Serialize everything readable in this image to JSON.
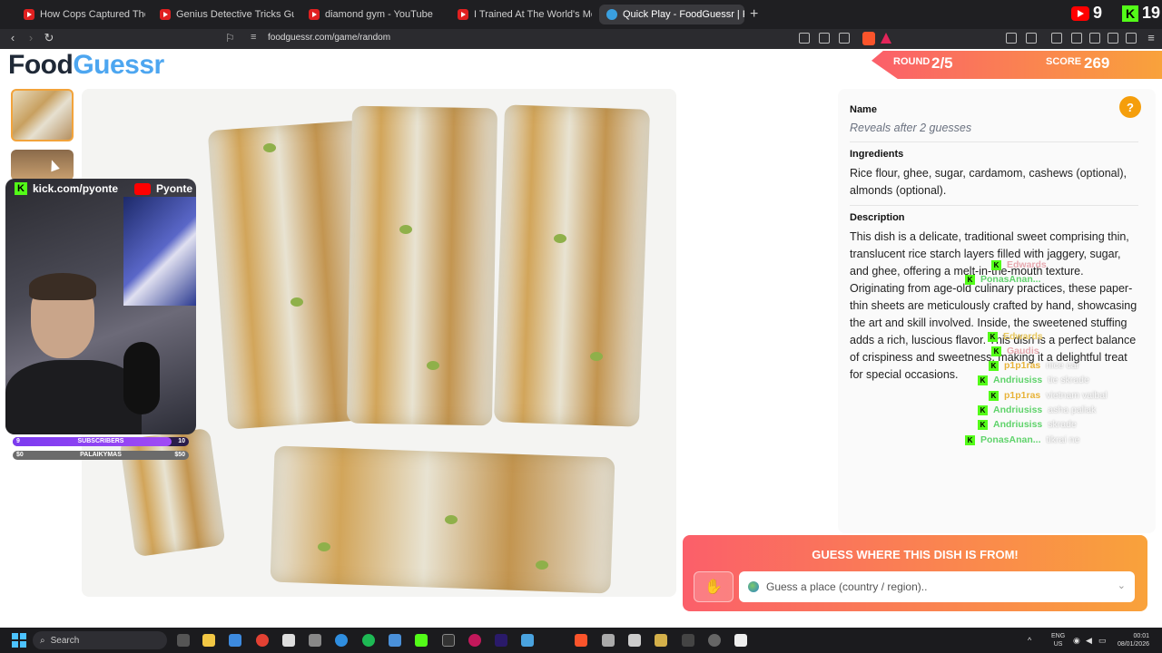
{
  "browser": {
    "tabs": [
      {
        "title": "How Cops Captured The Minnesota I",
        "active": false
      },
      {
        "title": "Genius Detective Tricks Guilty Suspe",
        "active": false
      },
      {
        "title": "diamond gym - YouTube",
        "active": false
      },
      {
        "title": "I Trained At The World's Most Dange",
        "active": false
      },
      {
        "title": "Quick Play - FoodGuessr | FoodG",
        "active": true
      }
    ],
    "new_tab": "+",
    "close": "✕",
    "youtube_count": "9",
    "kick_count": "19",
    "url": "foodguessr.com/game/random"
  },
  "site": {
    "logo_food": "Food",
    "logo_guessr": "Guessr",
    "round_label": "ROUND",
    "round_value": "2/5",
    "score_label": "SCORE",
    "score_value": "269"
  },
  "stream": {
    "kick_handle": "kick.com/pyonte",
    "youtube_name": "Pyonte",
    "subscribers": {
      "label": "SUBSCRIBERS",
      "current": "9",
      "goal": "10",
      "progress": 0.9
    },
    "donations": {
      "label": "PALAIKYMAS",
      "current": "$0",
      "goal": "$50",
      "progress": 0.0
    }
  },
  "info_panel": {
    "name_heading": "Name",
    "name_value": "Reveals after 2 guesses",
    "ingredients_heading": "Ingredients",
    "ingredients_text": "Rice flour, ghee, sugar, cardamom, cashews (optional), almonds (optional).",
    "description_heading": "Description",
    "description_text": "This dish is a delicate, traditional sweet comprising thin, translucent rice starch layers filled with jaggery, sugar, and ghee, offering a melt-in-the-mouth texture. Originating from age-old culinary practices, these paper-thin sheets are meticulously crafted by hand, showcasing the art and skill involved. Inside, the sweetened stuffing adds a rich, luscious flavor. This dish is a perfect balance of crispiness and sweetness, making it a delightful treat for special occasions.",
    "help": "?"
  },
  "chat": [
    {
      "user": "Edwards",
      "color": "#e7a9b0",
      "msg": ""
    },
    {
      "user": "PonasAnan...",
      "color": "#5fd36b",
      "msg": ""
    },
    {
      "user": "Edwards",
      "color": "#e7c75f",
      "msg": ""
    },
    {
      "user": "Gaudis",
      "color": "#e7a9b0",
      "msg": ""
    },
    {
      "user": "p1p1ras",
      "color": "#e8b339",
      "msg": "nice car"
    },
    {
      "user": "Andriusiss",
      "color": "#5fd36b",
      "msg": "tie skrade"
    },
    {
      "user": "p1p1ras",
      "color": "#e8b339",
      "msg": "vietnam vaibal"
    },
    {
      "user": "Andriusiss",
      "color": "#5fd36b",
      "msg": "asha paliak"
    },
    {
      "user": "Andriusiss",
      "color": "#5fd36b",
      "msg": "skrade"
    },
    {
      "user": "PonasAnan...",
      "color": "#5fd36b",
      "msg": "tikrai ne"
    }
  ],
  "guess": {
    "title": "GUESS WHERE THIS DISH IS FROM!",
    "placeholder": "Guess a place (country / region)..",
    "button_icon": "hand-icon"
  },
  "taskbar": {
    "search": "Search",
    "lang_top": "ENG",
    "lang_bottom": "US",
    "time": "00:01",
    "date": "08/01/2026"
  },
  "colors": {
    "accent_gradient_start": "#fb5f6a",
    "accent_gradient_end": "#f9a23b",
    "logo_blue": "#4da6f0",
    "kick_green": "#53fc18"
  }
}
